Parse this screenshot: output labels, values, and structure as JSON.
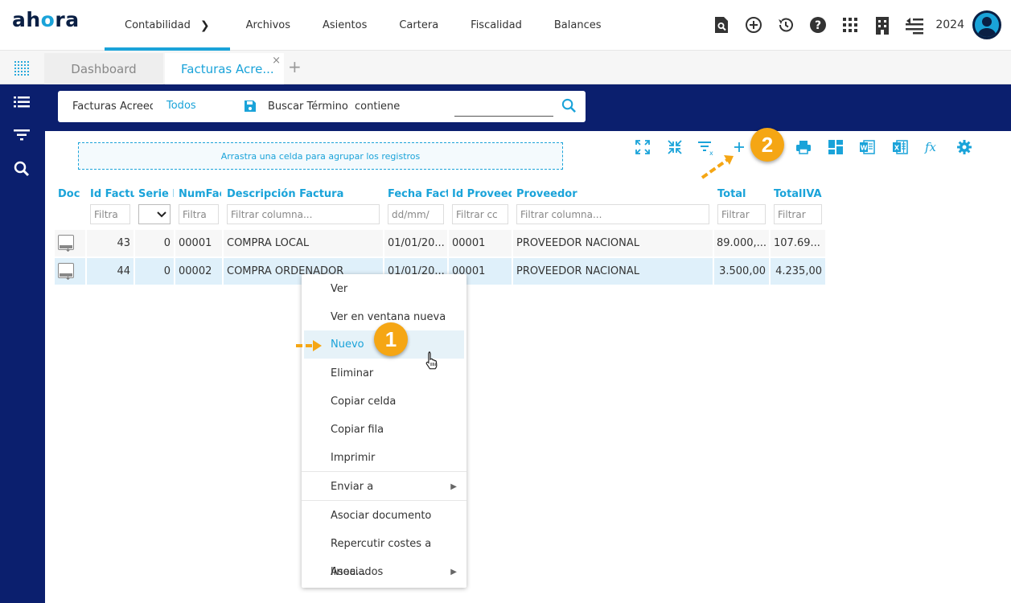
{
  "app": {
    "logo_prefix": "ah",
    "logo_o": "o",
    "logo_suffix": "ra",
    "year": "2024"
  },
  "nav": [
    "Contabilidad",
    "Archivos",
    "Asientos",
    "Cartera",
    "Fiscalidad",
    "Balances"
  ],
  "tabs": {
    "dashboard": "Dashboard",
    "facturas": "Facturas Acre...",
    "close": "×",
    "add": "+"
  },
  "search": {
    "scope": "Facturas Acreedc",
    "filter": "Todos",
    "term_label": "Buscar Término",
    "mode": "contiene"
  },
  "group_hint": "Arrastra una celda para agrupar los registros",
  "columns": [
    "Doc",
    "Id Factura",
    "Serie Fa",
    "NumFact",
    "Descripción Factura",
    "Fecha Factur",
    "Id Proveedor",
    "Proveedor",
    "Total",
    "TotalIVA"
  ],
  "filters": {
    "id_factura": "Filtra",
    "numfact": "Filtra",
    "descripcion": "Filtrar columna...",
    "fecha": "dd/mm/",
    "id_proveedor": "Filtrar cc",
    "proveedor": "Filtrar columna...",
    "total": "Filtrar",
    "totaliva": "Filtrar"
  },
  "rows": [
    {
      "id": "43",
      "serie": "0",
      "numfact": "00001",
      "descripcion": "COMPRA LOCAL",
      "fecha": "01/01/20...",
      "id_proveedor": "00001",
      "proveedor": "PROVEEDOR NACIONAL",
      "total": "89.000,...",
      "totaliva": "107.69..."
    },
    {
      "id": "44",
      "serie": "0",
      "numfact": "00002",
      "descripcion": "COMPRA ORDENADOR",
      "fecha": "01/01/20...",
      "id_proveedor": "00001",
      "proveedor": "PROVEEDOR NACIONAL",
      "total": "3.500,00",
      "totaliva": "4.235,00"
    }
  ],
  "context_menu": [
    "Ver",
    "Ver en ventana nueva",
    "Nuevo",
    "Eliminar",
    "Copiar celda",
    "Copiar fila",
    "Imprimir",
    "Enviar a",
    "Asociar documento",
    "Repercutir costes a linea...",
    "Asociados"
  ],
  "badges": [
    "1",
    "2"
  ],
  "colors": {
    "accent": "#1aa3d9",
    "navy": "#0b1f6e",
    "badge": "#f5a614",
    "highlight": "#e6f2f8"
  }
}
